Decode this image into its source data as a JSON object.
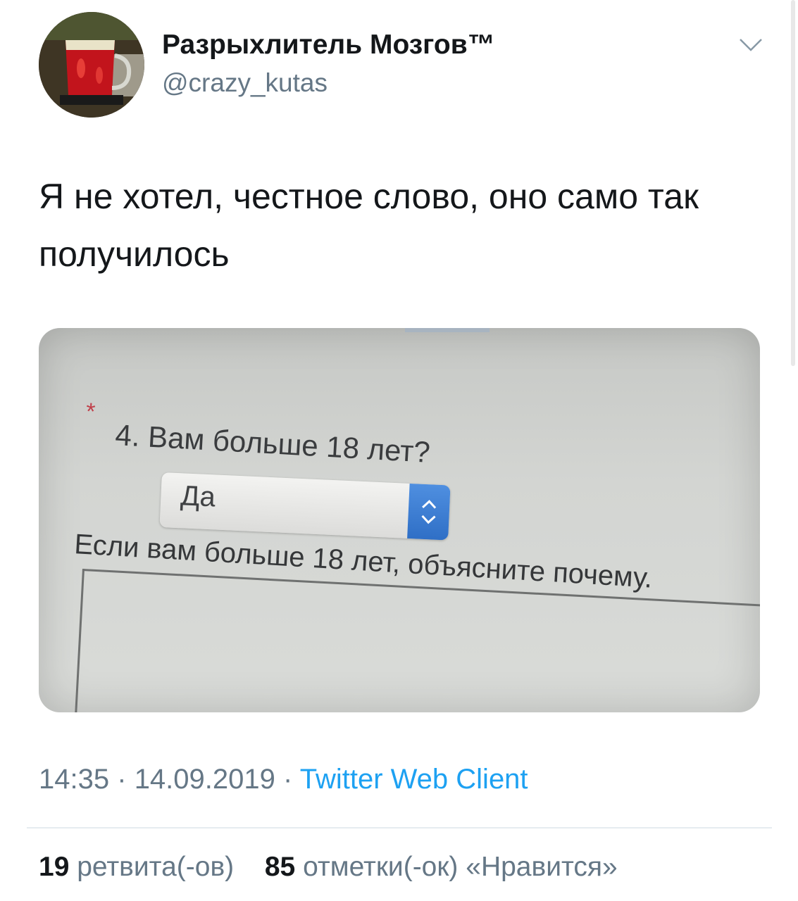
{
  "author": {
    "display_name": "Разрыхлитель Мозгов™",
    "handle": "@crazy_kutas"
  },
  "tweet": {
    "text": "Я не хотел, честное слово, оно само так получилось",
    "time": "14:35",
    "date": "14.09.2019",
    "separator": "·",
    "source": "Twitter Web Client"
  },
  "media": {
    "star": "*",
    "question": "4. Вам больше 18 лет?",
    "select_value": "Да",
    "instruction": "Если вам больше 18 лет, объясните почему."
  },
  "stats": {
    "retweets_count": "19",
    "retweets_label": "ретвита(-ов)",
    "likes_count": "85",
    "likes_label": "отметки(-ок) «Нравится»"
  },
  "colors": {
    "link": "#1da1f2",
    "secondary_text": "#657786",
    "primary_text": "#14171a",
    "stepper_blue": "#2f6fc6"
  },
  "icons": {
    "avatar": "beer-mug-avatar",
    "caret": "chevron-down-icon",
    "stepper": "up-down-arrows-icon"
  }
}
